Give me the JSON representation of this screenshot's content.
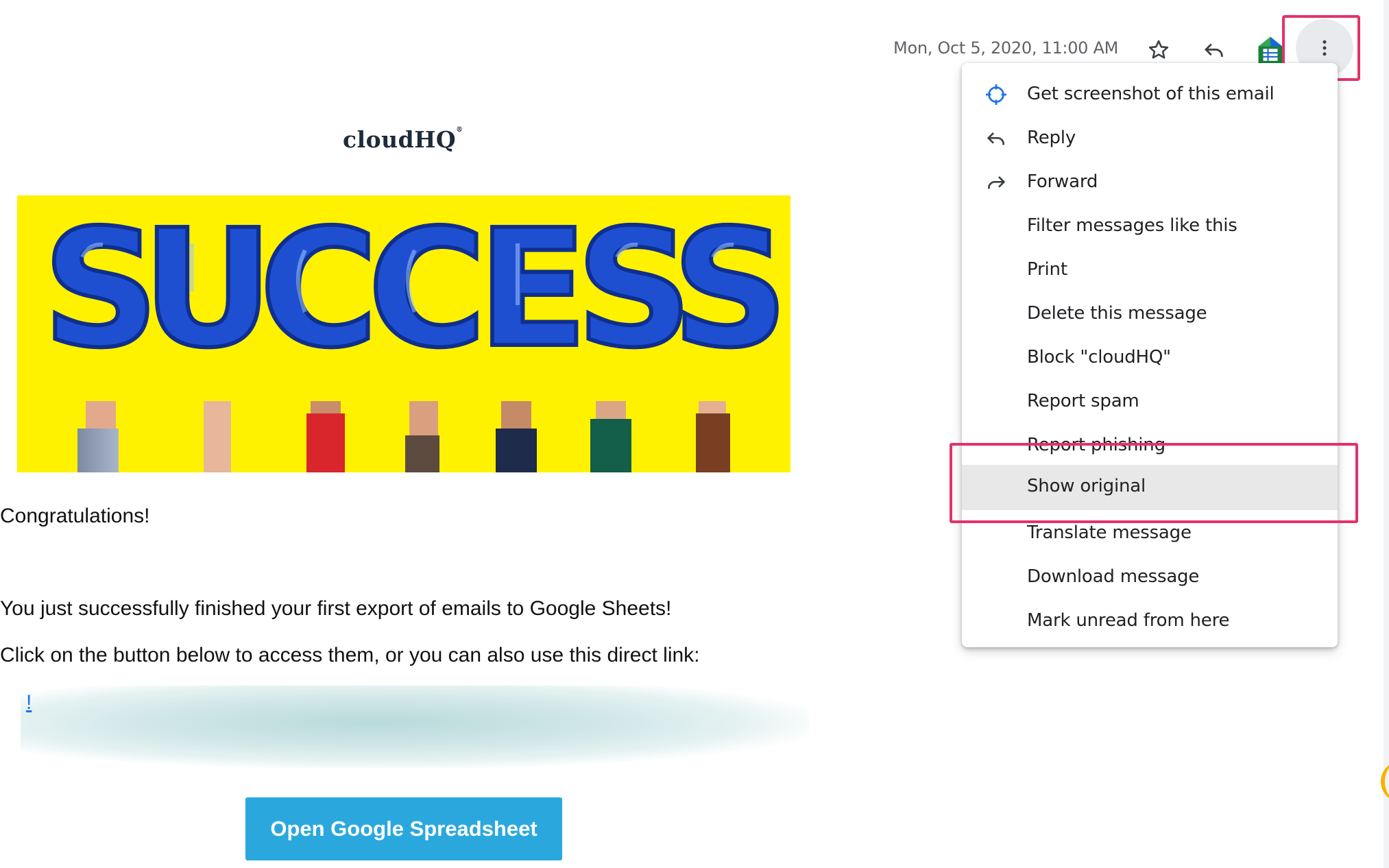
{
  "header": {
    "date": "Mon, Oct 5, 2020, 11:00 AM",
    "star_icon": "star-outline-icon",
    "reply_icon": "reply-arrow-icon",
    "addon_icon": "google-sheets-addon-icon",
    "more_icon": "more-vertical-icon"
  },
  "email": {
    "logo": "cloudHQ",
    "logo_mark": "®",
    "hero_word": "SUCCESS",
    "greeting": "Congratulations!",
    "line1": "You just successfully finished your first export of emails to Google Sheets!",
    "line2": "Click on the button below to access them, or you can also use this direct link:",
    "link_fragment": "!",
    "cta_label": "Open Google Spreadsheet"
  },
  "menu": {
    "items": [
      {
        "label": "Get screenshot of this email",
        "icon": "crosshair-icon"
      },
      {
        "label": "Reply",
        "icon": "reply-icon"
      },
      {
        "label": "Forward",
        "icon": "forward-icon"
      },
      {
        "label": "Filter messages like this",
        "icon": ""
      },
      {
        "label": "Print",
        "icon": ""
      },
      {
        "label": "Delete this message",
        "icon": ""
      },
      {
        "label": "Block \"cloudHQ\"",
        "icon": ""
      },
      {
        "label": "Report spam",
        "icon": ""
      },
      {
        "label": "Report phishing",
        "icon": ""
      },
      {
        "label": "Show original",
        "icon": "",
        "active": true
      },
      {
        "label": "Translate message",
        "icon": ""
      },
      {
        "label": "Download message",
        "icon": ""
      },
      {
        "label": "Mark unread from here",
        "icon": ""
      }
    ]
  },
  "colors": {
    "highlight": "#e3326a",
    "hero_background": "#fff200",
    "balloon_blue": "#1f4fd1",
    "cta_background": "#2aa8dd"
  }
}
